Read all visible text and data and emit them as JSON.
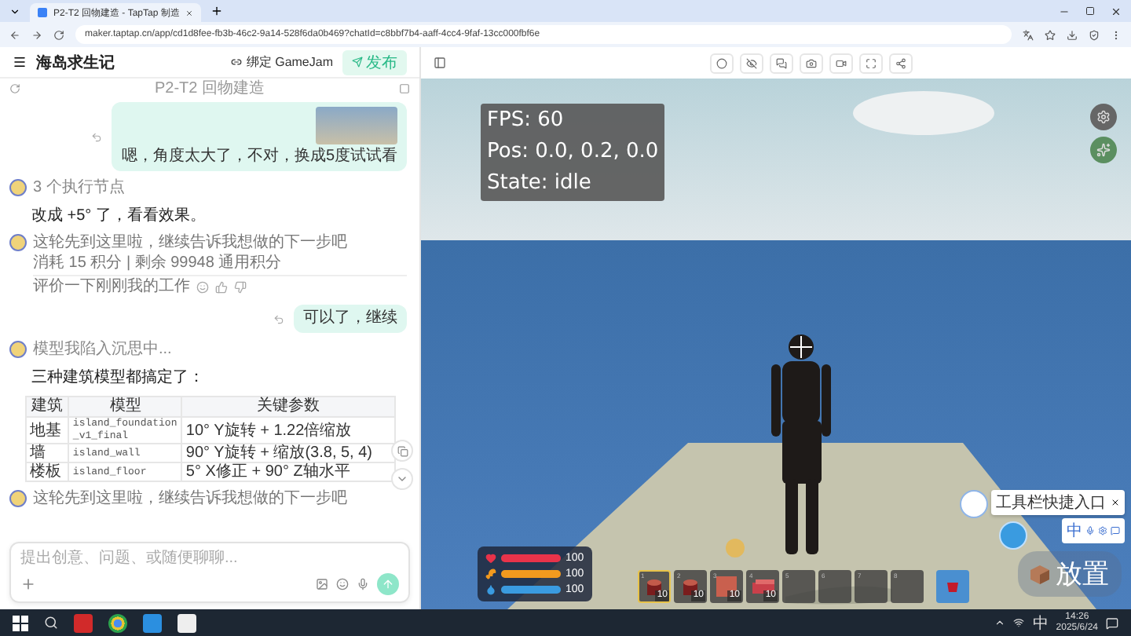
{
  "browser": {
    "tab_title": "P2-T2 回物建造 - TapTap 制造",
    "url": "maker.taptap.cn/app/cd1d8fee-fb3b-46c2-9a14-528f6da0b469?chatId=c8bbf7b4-aaff-4cc4-9faf-13cc000fbf6e"
  },
  "app_header": {
    "project_title": "海岛求生记",
    "bind_label": "绑定 GameJam",
    "publish_label": "发布"
  },
  "chat": {
    "title": "P2-T2 回物建造",
    "messages": [
      {
        "kind": "user",
        "has_image": true,
        "text": "嗯，角度太大了，不对，换成5度试试看"
      },
      {
        "kind": "steps",
        "text": "3 个执行节点"
      },
      {
        "kind": "assistant",
        "text": "改成 +5° 了，看看效果。"
      },
      {
        "kind": "status",
        "text": "这轮先到这里啦，继续告诉我想做的下一步吧",
        "credits": "消耗 15 积分 | 剩余 99948 通用积分",
        "rating_prompt": "评价一下刚刚我的工作"
      },
      {
        "kind": "user",
        "has_image": false,
        "text": "可以了，继续"
      },
      {
        "kind": "thinking",
        "text": "模型我陷入沉思中..."
      },
      {
        "kind": "assistant",
        "text": "三种建筑模型都搞定了："
      },
      {
        "kind": "table",
        "columns": [
          "建筑",
          "模型",
          "关键参数"
        ],
        "rows": [
          [
            "地基",
            "island_foundation_v1_final",
            "10° Y旋转 + 1.22倍缩放"
          ],
          [
            "墙",
            "island_wall",
            "90° Y旋转 + 缩放(3.8, 5, 4)"
          ],
          [
            "楼板",
            "island_floor",
            "5° X修正 + 90° Z轴水平"
          ]
        ]
      },
      {
        "kind": "status",
        "text": "这轮先到这里啦，继续告诉我想做的下一步吧"
      }
    ]
  },
  "composer": {
    "placeholder": "提出创意、问题、或随便聊聊..."
  },
  "game": {
    "hud": [
      "FPS: 60",
      "Pos: 0.0, 0.2, 0.0",
      "State: idle"
    ],
    "stats": [
      {
        "kind": "health",
        "color": "#e8334a",
        "level": 1,
        "value": "100"
      },
      {
        "kind": "hunger",
        "color": "#f29a1e",
        "level": 1,
        "value": "100"
      },
      {
        "kind": "thirst",
        "color": "#3a9be0",
        "level": 1,
        "value": "100"
      }
    ],
    "hotbar": [
      {
        "number": "1",
        "kind": "log",
        "count": "10",
        "selected": true
      },
      {
        "number": "2",
        "kind": "log",
        "count": "10",
        "selected": false
      },
      {
        "number": "3",
        "kind": "block",
        "count": "10",
        "selected": false
      },
      {
        "number": "4",
        "kind": "brick",
        "count": "10",
        "selected": false
      },
      {
        "number": "5",
        "kind": "empty",
        "selected": false
      },
      {
        "number": "6",
        "kind": "empty",
        "selected": false
      },
      {
        "number": "7",
        "kind": "empty",
        "selected": false
      },
      {
        "number": "8",
        "kind": "empty",
        "selected": false
      }
    ],
    "place_button": "放置",
    "tooltip": "工具栏快捷入口",
    "ime_label": "中"
  },
  "taskbar": {
    "ime_label": "中",
    "time": "14:26",
    "date": "2025/6/24"
  }
}
